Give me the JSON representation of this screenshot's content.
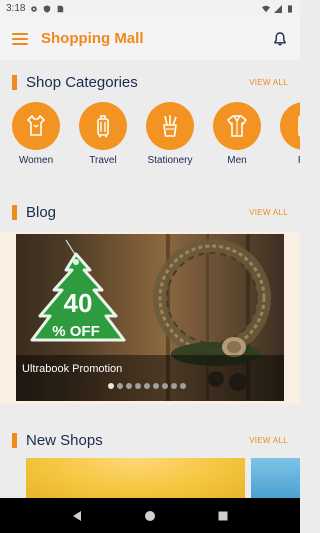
{
  "status_bar": {
    "time": "3:18"
  },
  "app_bar": {
    "title": "Shopping Mall"
  },
  "sections": {
    "categories": {
      "title": "Shop Categories",
      "view_all": "VIEW ALL"
    },
    "blog": {
      "title": "Blog",
      "view_all": "VIEW ALL"
    },
    "new_shops": {
      "title": "New Shops",
      "view_all": "VIEW ALL"
    }
  },
  "categories": [
    {
      "label": "Women",
      "icon": "dress-icon"
    },
    {
      "label": "Travel",
      "icon": "suitcase-icon"
    },
    {
      "label": "Stationery",
      "icon": "pencil-cup-icon"
    },
    {
      "label": "Men",
      "icon": "shirt-icon"
    },
    {
      "label": "Ph",
      "icon": "phone-icon"
    }
  ],
  "blog": {
    "title": "Ultrabook Promotion",
    "tag_percent": "40",
    "tag_off": "% OFF",
    "slide_count": 9,
    "active_slide": 1
  },
  "colors": {
    "accent": "#f08a1d",
    "title": "#1b2a4e",
    "tag": "#2e9b3e"
  }
}
